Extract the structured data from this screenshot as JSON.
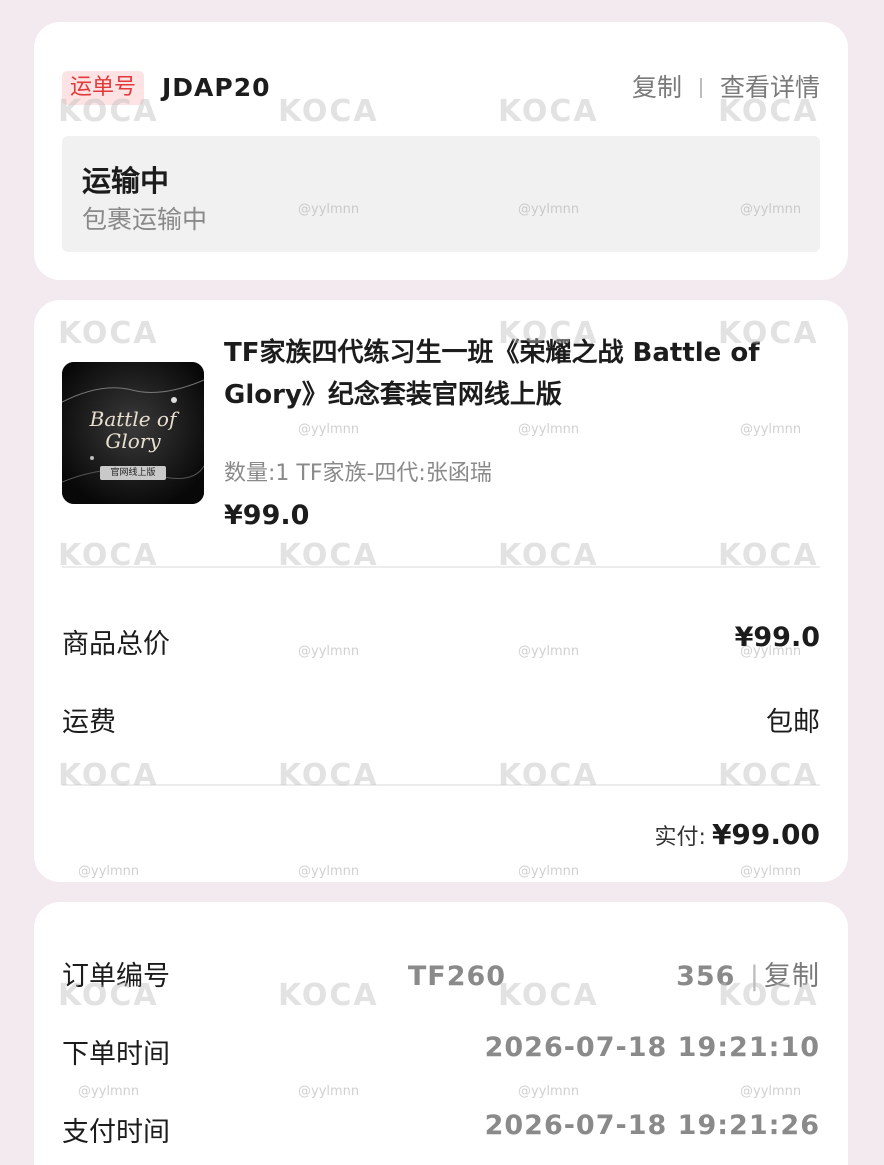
{
  "waybill": {
    "tag": "运单号",
    "number": "JDAP20",
    "copy_label": "复制",
    "details_label": "查看详情"
  },
  "status": {
    "title": "运输中",
    "subtitle": "包裹运输中"
  },
  "product": {
    "title": "TF家族四代练习生一班《荣耀之战 Battle of Glory》纪念套装官网线上版",
    "spec": "数量:1 TF家族-四代:张函瑞",
    "price": "¥99.0",
    "cover_text": "Battle of Glory",
    "cover_badge": "官网线上版"
  },
  "summary": {
    "subtotal_label": "商品总价",
    "subtotal_value": "¥99.0",
    "shipping_label": "运费",
    "shipping_value": "包邮",
    "paid_label": "实付:",
    "paid_value": "¥99.00"
  },
  "order": {
    "number_label": "订单编号",
    "number_value": "TF260",
    "number_tail": "356",
    "copy_label": "复制",
    "placed_label": "下单时间",
    "placed_value": "2026-07-18 19:21:10",
    "paid_label": "支付时间",
    "paid_value": "2026-07-18 19:21:26"
  },
  "watermark": {
    "logo": "KOCA",
    "handle": "@yylmnn"
  },
  "colors": {
    "background": "#f3eaf0",
    "tag_bg": "#fde3e3",
    "tag_text": "#e23a3a",
    "muted": "#8a8a8a"
  }
}
